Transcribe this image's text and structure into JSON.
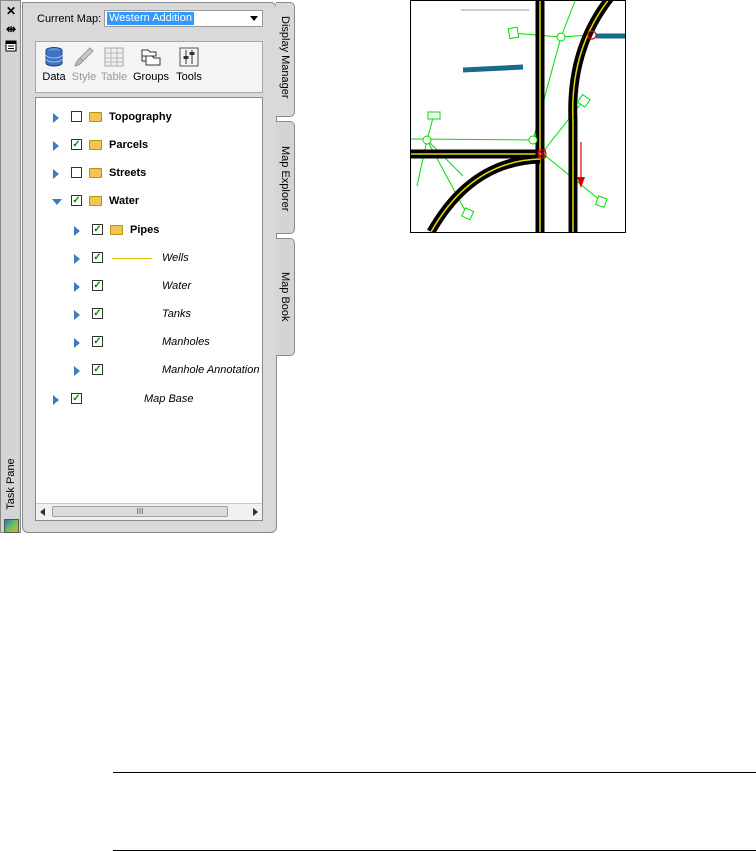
{
  "task_pane": {
    "strip_label": "Task Pane",
    "close_icon": "close-icon",
    "autohide_icon": "autohide-icon",
    "properties_icon": "properties-icon"
  },
  "current_map": {
    "label": "Current Map:",
    "value": "Western Addition"
  },
  "toolbar": {
    "items": [
      {
        "label": "Data",
        "icon": "database-icon",
        "enabled": true
      },
      {
        "label": "Style",
        "icon": "brush-icon",
        "enabled": false
      },
      {
        "label": "Table",
        "icon": "table-icon",
        "enabled": false
      },
      {
        "label": "Groups",
        "icon": "groups-icon",
        "enabled": true
      },
      {
        "label": "Tools",
        "icon": "tools-icon",
        "enabled": true
      }
    ]
  },
  "tree": {
    "items": [
      {
        "label": "Topography",
        "checked": false,
        "folder": true,
        "level": 0
      },
      {
        "label": "Parcels",
        "checked": true,
        "folder": true,
        "level": 0
      },
      {
        "label": "Streets",
        "checked": false,
        "folder": true,
        "level": 0
      },
      {
        "label": "Water",
        "checked": true,
        "folder": true,
        "level": 0,
        "expanded": true
      },
      {
        "label": "Pipes",
        "checked": true,
        "folder": true,
        "level": 1
      },
      {
        "label": "Wells",
        "checked": true,
        "folder": false,
        "level": 1,
        "style_line": true
      },
      {
        "label": "Water",
        "checked": true,
        "folder": false,
        "level": 1
      },
      {
        "label": "Tanks",
        "checked": true,
        "folder": false,
        "level": 1
      },
      {
        "label": "Manholes",
        "checked": true,
        "folder": false,
        "level": 1
      },
      {
        "label": "Manhole Annotation",
        "checked": true,
        "folder": false,
        "level": 1
      },
      {
        "label": "Map Base",
        "checked": true,
        "folder": false,
        "level": 0
      }
    ],
    "scroll_thumb": "III"
  },
  "tabs": {
    "display_manager": "Display Manager",
    "map_explorer": "Map Explorer",
    "map_book": "Map Book"
  },
  "colors": {
    "road": "#000000",
    "road_center": "#e6d800",
    "pipe": "#00dd00",
    "water_main": "#1a6a8a",
    "selection": "#dd0000"
  }
}
